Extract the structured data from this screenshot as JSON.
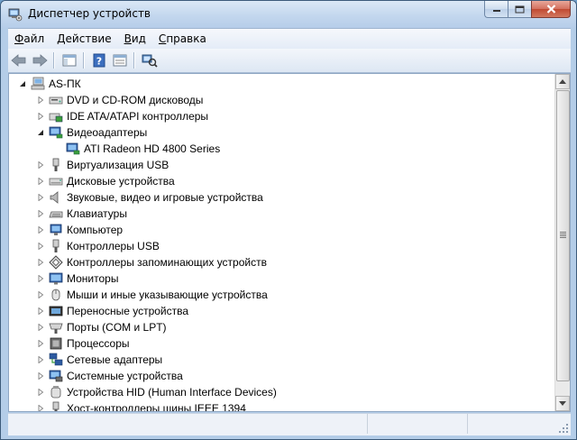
{
  "window": {
    "title": "Диспетчер устройств",
    "icon": "device-manager-icon"
  },
  "menubar": {
    "items": [
      {
        "accel": "Ф",
        "rest": "айл"
      },
      {
        "accel": "Д",
        "rest": "ействие"
      },
      {
        "accel": "В",
        "rest": "ид"
      },
      {
        "accel": "С",
        "rest": "правка"
      }
    ]
  },
  "toolbar": {
    "buttons": [
      "back-icon",
      "forward-icon",
      "show-hide-console-tree-icon",
      "help-icon",
      "properties-icon",
      "scan-hardware-icon"
    ]
  },
  "tree": {
    "root": {
      "label": "AS-ПК",
      "icon": "computer-icon",
      "expanded": true
    },
    "items": [
      {
        "label": "DVD и CD-ROM дисководы",
        "icon": "dvd-drive-icon",
        "expanded": false
      },
      {
        "label": "IDE ATA/ATAPI контроллеры",
        "icon": "ide-controller-icon",
        "expanded": false
      },
      {
        "label": "Видеоадаптеры",
        "icon": "display-adapter-icon",
        "expanded": true,
        "children": [
          {
            "label": "ATI Radeon HD 4800 Series",
            "icon": "display-adapter-icon"
          }
        ]
      },
      {
        "label": "Виртуализация USB",
        "icon": "usb-icon",
        "expanded": false
      },
      {
        "label": "Дисковые устройства",
        "icon": "disk-drive-icon",
        "expanded": false
      },
      {
        "label": "Звуковые, видео и игровые устройства",
        "icon": "speaker-icon",
        "expanded": false
      },
      {
        "label": "Клавиатуры",
        "icon": "keyboard-icon",
        "expanded": false
      },
      {
        "label": "Компьютер",
        "icon": "computer-icon",
        "expanded": false
      },
      {
        "label": "Контроллеры USB",
        "icon": "usb-icon",
        "expanded": false
      },
      {
        "label": "Контроллеры запоминающих устройств",
        "icon": "storage-controller-icon",
        "expanded": false
      },
      {
        "label": "Мониторы",
        "icon": "monitor-icon",
        "expanded": false
      },
      {
        "label": "Мыши и иные указывающие устройства",
        "icon": "mouse-icon",
        "expanded": false
      },
      {
        "label": "Переносные устройства",
        "icon": "portable-device-icon",
        "expanded": false
      },
      {
        "label": "Порты (COM и LPT)",
        "icon": "port-icon",
        "expanded": false
      },
      {
        "label": "Процессоры",
        "icon": "processor-icon",
        "expanded": false
      },
      {
        "label": "Сетевые адаптеры",
        "icon": "network-adapter-icon",
        "expanded": false
      },
      {
        "label": "Системные устройства",
        "icon": "system-device-icon",
        "expanded": false
      },
      {
        "label": "Устройства HID (Human Interface Devices)",
        "icon": "hid-icon",
        "expanded": false
      },
      {
        "label": "Хост-контроллеры шины IEEE 1394",
        "icon": "ieee1394-icon",
        "expanded": false
      }
    ]
  },
  "colors": {
    "accent": "#3a6ea5",
    "close_button": "#c7503a"
  }
}
